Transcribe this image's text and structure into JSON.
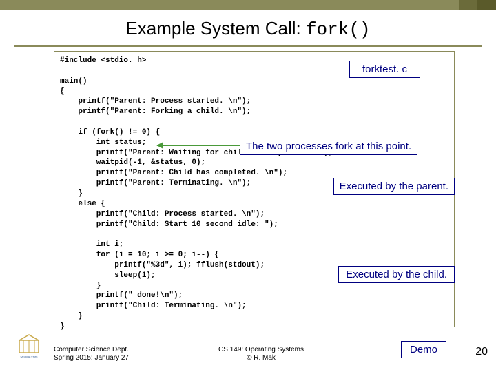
{
  "title_prefix": "Example System Call: ",
  "title_code": "fork()",
  "file_label": "forktest. c",
  "code": "#include <stdio. h>\n\nmain()\n{\n    printf(\"Parent: Process started. \\n\");\n    printf(\"Parent: Forking a child. \\n\");\n\n    if (fork() != 0) {\n        int status;\n        printf(\"Parent: Waiting for child to complete. \\n\");\n        waitpid(-1, &status, 0);\n        printf(\"Parent: Child has completed. \\n\");\n        printf(\"Parent: Terminating. \\n\");\n    }\n    else {\n        printf(\"Child: Process started. \\n\");\n        printf(\"Child: Start 10 second idle: \");\n\n        int i;\n        for (i = 10; i >= 0; i--) {\n            printf(\"%3d\", i); fflush(stdout);\n            sleep(1);\n        }\n        printf(\" done!\\n\");\n        printf(\"Child: Terminating. \\n\");\n    }\n}",
  "annotations": {
    "fork": "The two processes fork at this point.",
    "parent": "Executed by the parent.",
    "child": "Executed by the child.",
    "demo": "Demo"
  },
  "footer": {
    "left1": "Computer Science Dept.",
    "left2": "Spring 2015: January 27",
    "mid1": "CS 149: Operating Systems",
    "mid2": "© R. Mak"
  },
  "page_number": "20",
  "logo_alt": "San Jose State University"
}
